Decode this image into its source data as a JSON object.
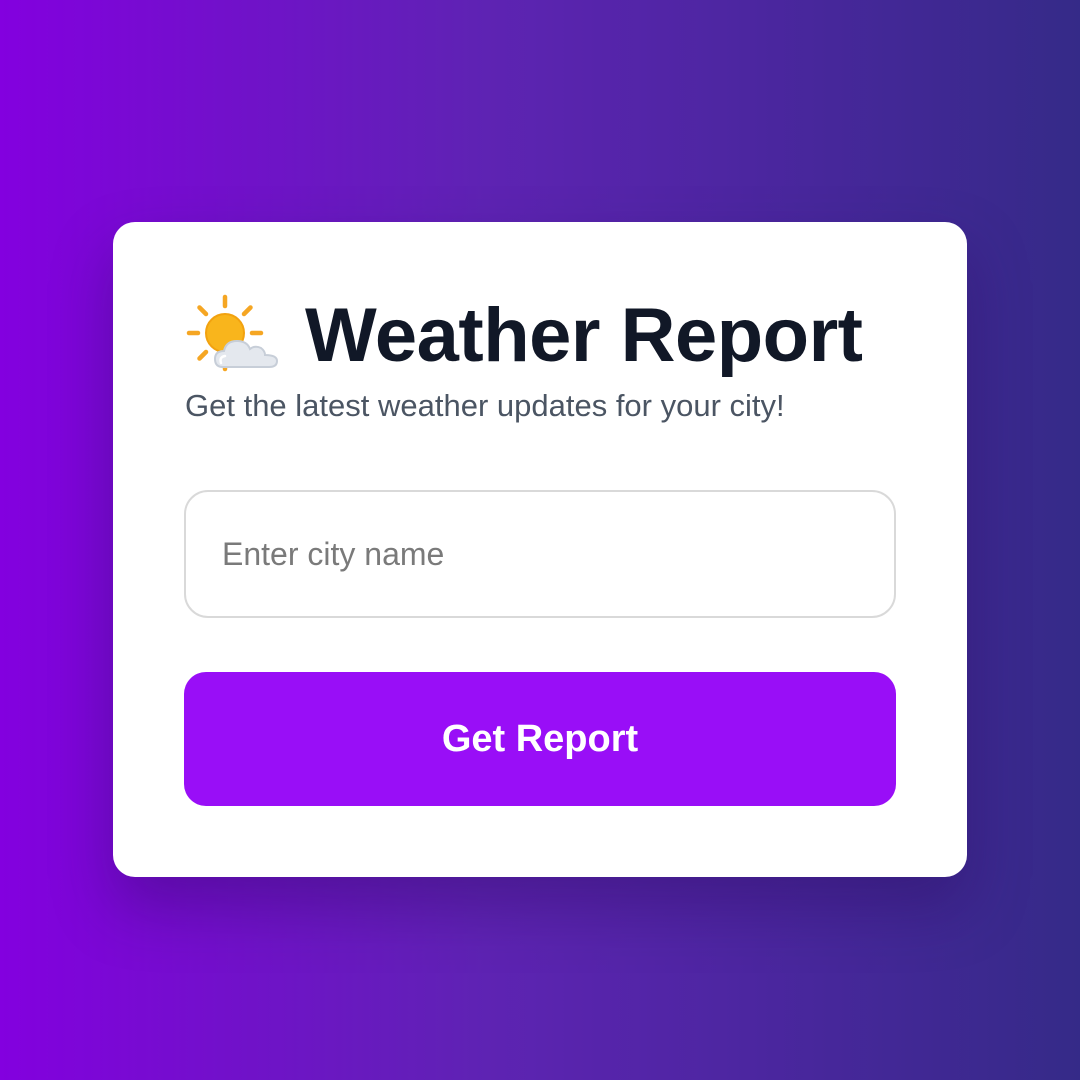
{
  "header": {
    "icon": "sun-behind-cloud-icon",
    "title": "Weather Report",
    "subtitle": "Get the latest weather updates for your city!"
  },
  "form": {
    "city_input": {
      "placeholder": "Enter city name",
      "value": ""
    },
    "submit_label": "Get Report"
  },
  "colors": {
    "background_gradient_start": "#8300df",
    "background_gradient_end": "#352a88",
    "card": "#ffffff",
    "title": "#111827",
    "subtitle": "#4b5563",
    "button": "#990ef7",
    "button_text": "#ffffff",
    "sun": "#f9b51c"
  }
}
